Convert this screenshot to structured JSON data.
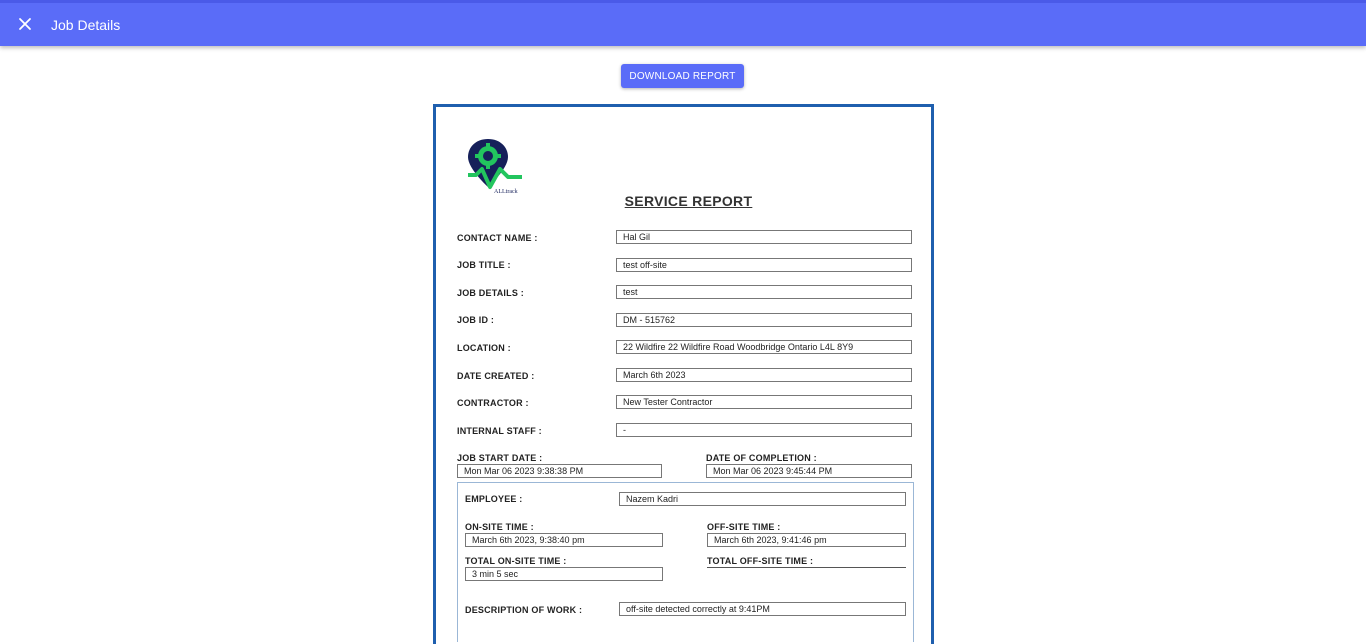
{
  "appbar": {
    "title": "Job Details",
    "close_icon": "close-icon"
  },
  "actions": {
    "download_label": "DOWNLOAD REPORT"
  },
  "report": {
    "logo_text": "ALLtrack",
    "title": "SERVICE REPORT",
    "fields": [
      {
        "label": "CONTACT NAME :",
        "value": "Hal Gil"
      },
      {
        "label": "JOB TITLE :",
        "value": "test off-site"
      },
      {
        "label": "JOB DETAILS :",
        "value": "test"
      },
      {
        "label": "JOB ID :",
        "value": "DM - 515762"
      },
      {
        "label": "LOCATION :",
        "value": "22 Wildfire 22 Wildfire Road Woodbridge Ontario L4L 8Y9"
      },
      {
        "label": "DATE CREATED :",
        "value": "March 6th 2023"
      },
      {
        "label": "CONTRACTOR :",
        "value": "New Tester Contractor"
      },
      {
        "label": "INTERNAL STAFF :",
        "value": "-"
      }
    ],
    "job_start": {
      "label": "JOB START DATE :",
      "value": "Mon Mar 06 2023 9:38:38 PM"
    },
    "completion": {
      "label": "DATE OF COMPLETION :",
      "value": "Mon Mar 06 2023 9:45:44 PM"
    },
    "employee": {
      "label": "EMPLOYEE :",
      "value": "Nazem Kadri",
      "onsite": {
        "label": "ON-SITE TIME :",
        "value": "March 6th 2023, 9:38:40 pm"
      },
      "offsite": {
        "label": "OFF-SITE TIME :",
        "value": "March 6th 2023, 9:41:46 pm"
      },
      "total_onsite": {
        "label": "TOTAL ON-SITE TIME :",
        "value": "3 min 5 sec"
      },
      "total_offsite": {
        "label": "TOTAL OFF-SITE TIME :",
        "value": ""
      },
      "description": {
        "label": "DESCRIPTION OF WORK :",
        "value": "off-site detected correctly at 9:41PM"
      }
    }
  },
  "colors": {
    "appbar": "#5a6cf8",
    "report_border": "#1f5fae",
    "logo_navy": "#16205a",
    "logo_green": "#22c55e"
  }
}
